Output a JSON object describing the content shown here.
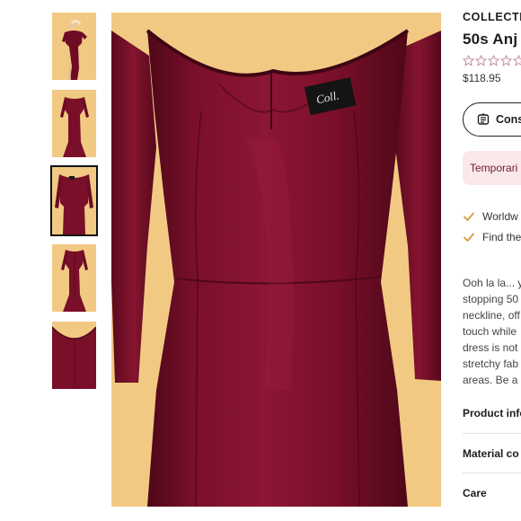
{
  "product": {
    "brand": "COLLECTI",
    "title": "50s Anj",
    "rating_filled": 0,
    "rating_max": 5,
    "price": "$118.95"
  },
  "consult_button": {
    "label": "Cons",
    "icon": "hanger-icon"
  },
  "notice": {
    "label": "Temporari"
  },
  "features": [
    {
      "label": "Worldw",
      "icon": "check-icon"
    },
    {
      "label": "Find the",
      "icon": "check-icon"
    }
  ],
  "description": [
    "Ooh la la... y",
    "stopping 50",
    "neckline, off",
    "touch while",
    "dress is not",
    "stretchy fab",
    "areas. Be a"
  ],
  "accordion": [
    {
      "label": "Product info"
    },
    {
      "label": "Material co"
    },
    {
      "label": "Care"
    }
  ],
  "gallery": {
    "selected_index": 2,
    "thumbnails": [
      {
        "name": "full-length-pose"
      },
      {
        "name": "front-full"
      },
      {
        "name": "front-crop"
      },
      {
        "name": "back-full"
      },
      {
        "name": "neckline-detail"
      }
    ],
    "colors": {
      "background": "#f2c983",
      "velvet": "#7a0f2a",
      "velvet_dark": "#4e0818"
    }
  },
  "colors": {
    "star": "#c28a9a",
    "accent": "#6b1d2e",
    "notice_bg": "#fbe8eb",
    "check": "#d49a3a"
  }
}
